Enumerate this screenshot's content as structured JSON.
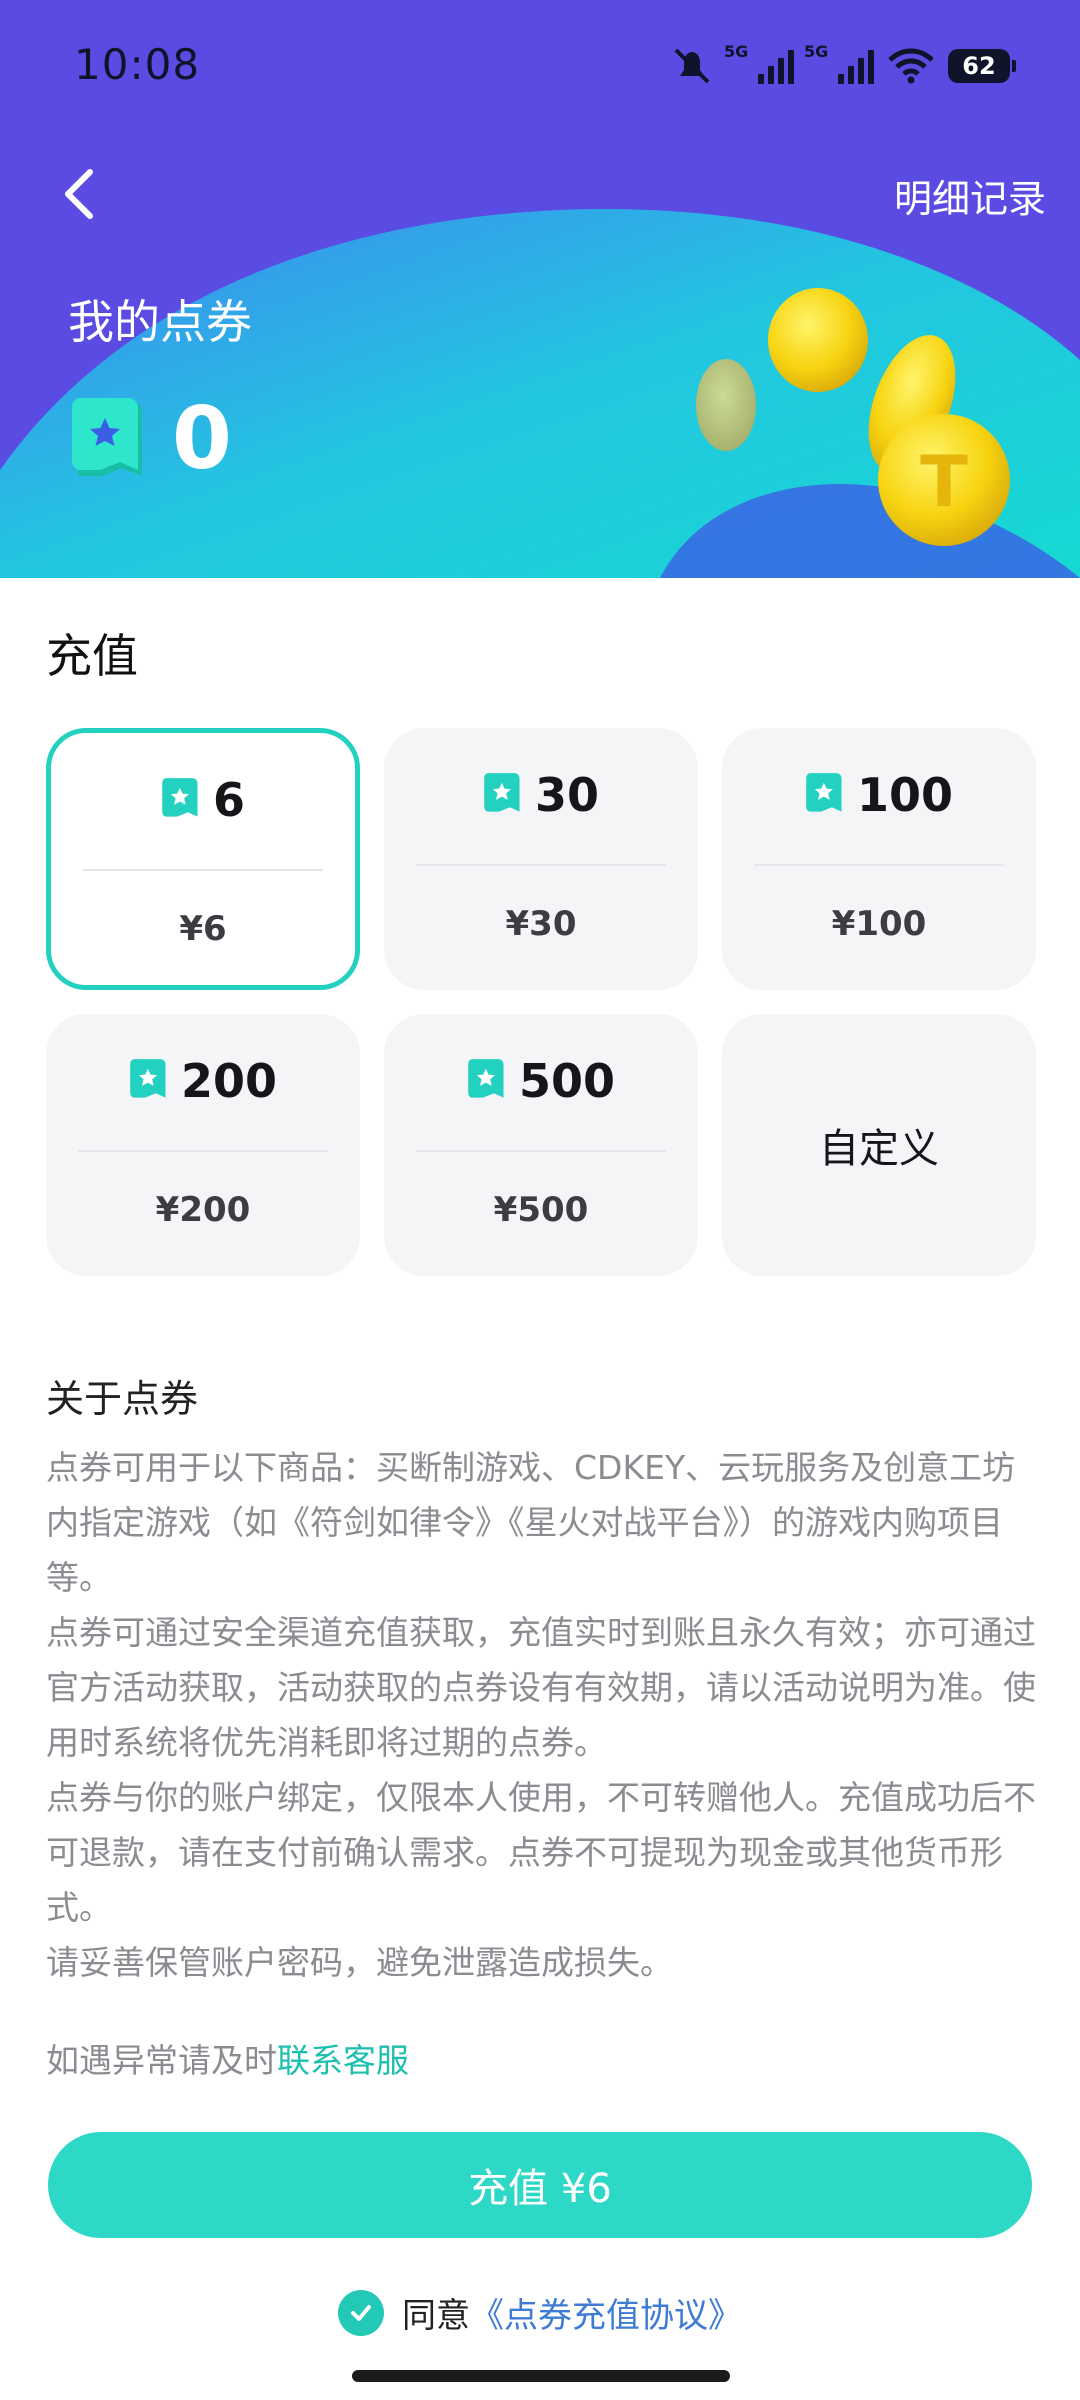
{
  "status_bar": {
    "time": "10:08",
    "battery": "62",
    "signal_label": "5G"
  },
  "header": {
    "details_label": "明细记录",
    "title": "我的点券",
    "balance": "0"
  },
  "recharge": {
    "section_title": "充值",
    "options": [
      {
        "points": "6",
        "price": "¥6",
        "selected": true
      },
      {
        "points": "30",
        "price": "¥30"
      },
      {
        "points": "100",
        "price": "¥100"
      },
      {
        "points": "200",
        "price": "¥200"
      },
      {
        "points": "500",
        "price": "¥500"
      }
    ],
    "custom_label": "自定义"
  },
  "about": {
    "title": "关于点券",
    "paragraphs": [
      "点券可用于以下商品：买断制游戏、CDKEY、云玩服务及创意工坊内指定游戏（如《符剑如律令》《星火对战平台》）的游戏内购项目等。",
      "点券可通过安全渠道充值获取，充值实时到账且永久有效；亦可通过官方活动获取，活动获取的点券设有有效期，请以活动说明为准。使用时系统将优先消耗即将过期的点券。",
      "点券与你的账户绑定，仅限本人使用，不可转赠他人。充值成功后不可退款，请在支付前确认需求。点券不可提现为现金或其他货币形式。",
      "请妥善保管账户密码，避免泄露造成损失。"
    ],
    "contact_prefix": "如遇异常请及时",
    "contact_link": "联系客服"
  },
  "footer": {
    "pay_button": "充值 ¥6",
    "agree_text": "同意",
    "agreement_link": "《点券充值协议》"
  },
  "colors": {
    "header_bg": "#5A4BE3",
    "accent": "#2ED8C7",
    "teal": "#22D1BF",
    "link_blue": "#3E7BD4"
  },
  "icons": [
    "back-arrow-icon",
    "ticket-icon",
    "check-icon",
    "coin-icon"
  ]
}
